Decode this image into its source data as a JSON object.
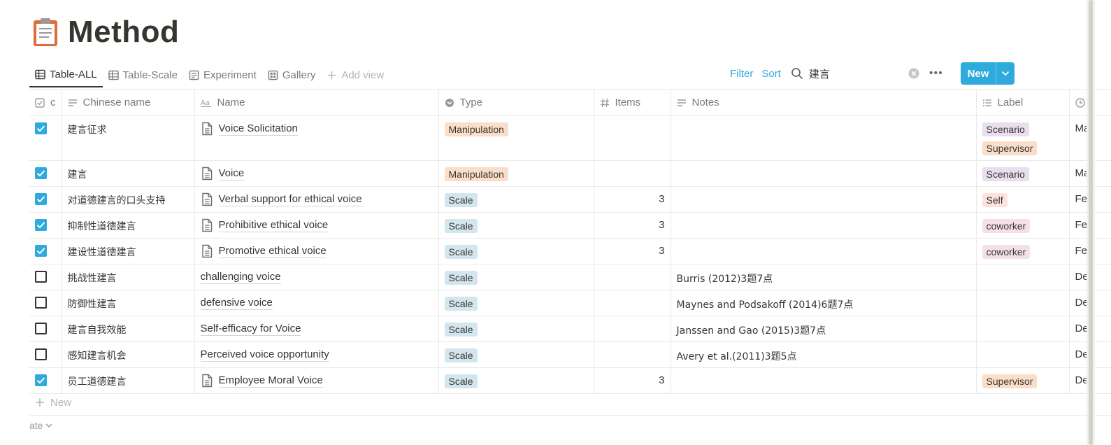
{
  "page": {
    "title": "Method",
    "icon": "clipboard-icon"
  },
  "views": {
    "tabs": [
      {
        "label": "Table-ALL",
        "icon": "table-icon",
        "active": true
      },
      {
        "label": "Table-Scale",
        "icon": "table-icon",
        "active": false
      },
      {
        "label": "Experiment",
        "icon": "list-icon",
        "active": false
      },
      {
        "label": "Gallery",
        "icon": "gallery-icon",
        "active": false
      }
    ],
    "add_view_label": "Add view"
  },
  "toolbar": {
    "filter_label": "Filter",
    "sort_label": "Sort",
    "search_value": "建言",
    "new_label": "New"
  },
  "columns": {
    "checkbox": "c",
    "chinese_name": "Chinese name",
    "name": "Name",
    "type": "Type",
    "items": "Items",
    "notes": "Notes",
    "label": "Label"
  },
  "rows": [
    {
      "checked": true,
      "chinese_name": "建言征求",
      "has_page": true,
      "name": "Voice Solicitation",
      "type": "Manipulation",
      "items": "",
      "notes": "",
      "labels": [
        "Scenario",
        "Supervisor"
      ],
      "trunc": "Ma"
    },
    {
      "checked": true,
      "chinese_name": "建言",
      "has_page": true,
      "name": "Voice",
      "type": "Manipulation",
      "items": "",
      "notes": "",
      "labels": [
        "Scenario"
      ],
      "trunc": "Ma"
    },
    {
      "checked": true,
      "chinese_name": "对道德建言的口头支持",
      "has_page": true,
      "name": "Verbal support for ethical voice",
      "type": "Scale",
      "items": "3",
      "notes": "",
      "labels": [
        "Self"
      ],
      "trunc": "Fe"
    },
    {
      "checked": true,
      "chinese_name": "抑制性道德建言",
      "has_page": true,
      "name": "Prohibitive ethical voice",
      "type": "Scale",
      "items": "3",
      "notes": "",
      "labels": [
        "coworker"
      ],
      "trunc": "Fe"
    },
    {
      "checked": true,
      "chinese_name": "建设性道德建言",
      "has_page": true,
      "name": "Promotive ethical voice",
      "type": "Scale",
      "items": "3",
      "notes": "",
      "labels": [
        "coworker"
      ],
      "trunc": "Fe"
    },
    {
      "checked": false,
      "chinese_name": "挑战性建言",
      "has_page": false,
      "name": "challenging voice",
      "type": "Scale",
      "items": "",
      "notes": "Burris (2012)3题7点",
      "labels": [],
      "trunc": "De"
    },
    {
      "checked": false,
      "chinese_name": "防御性建言",
      "has_page": false,
      "name": "defensive voice",
      "type": "Scale",
      "items": "",
      "notes": "Maynes and Podsakoff (2014)6题7点",
      "labels": [],
      "trunc": "De"
    },
    {
      "checked": false,
      "chinese_name": "建言自我效能",
      "has_page": false,
      "name": "Self-efficacy for Voice",
      "type": "Scale",
      "items": "",
      "notes": "Janssen and Gao (2015)3题7点",
      "labels": [],
      "trunc": "De"
    },
    {
      "checked": false,
      "chinese_name": "感知建言机会",
      "has_page": false,
      "name": "Perceived voice opportunity",
      "type": "Scale",
      "items": "",
      "notes": "Avery et al.(2011)3题5点",
      "labels": [],
      "trunc": "De"
    },
    {
      "checked": true,
      "chinese_name": "员工道德建言",
      "has_page": true,
      "name": "Employee Moral Voice",
      "type": "Scale",
      "items": "3",
      "notes": "",
      "labels": [
        "Supervisor"
      ],
      "trunc": "De"
    }
  ],
  "tag_colors": {
    "Manipulation": "#fadec9",
    "Scale": "#d3e5ef",
    "Scenario": "#e8deee",
    "Supervisor": "#fadec9",
    "Self": "#ffe2dd",
    "coworker": "#f5e0e9"
  },
  "footer": {
    "new_row_label": "New",
    "calc_label": "ate"
  }
}
